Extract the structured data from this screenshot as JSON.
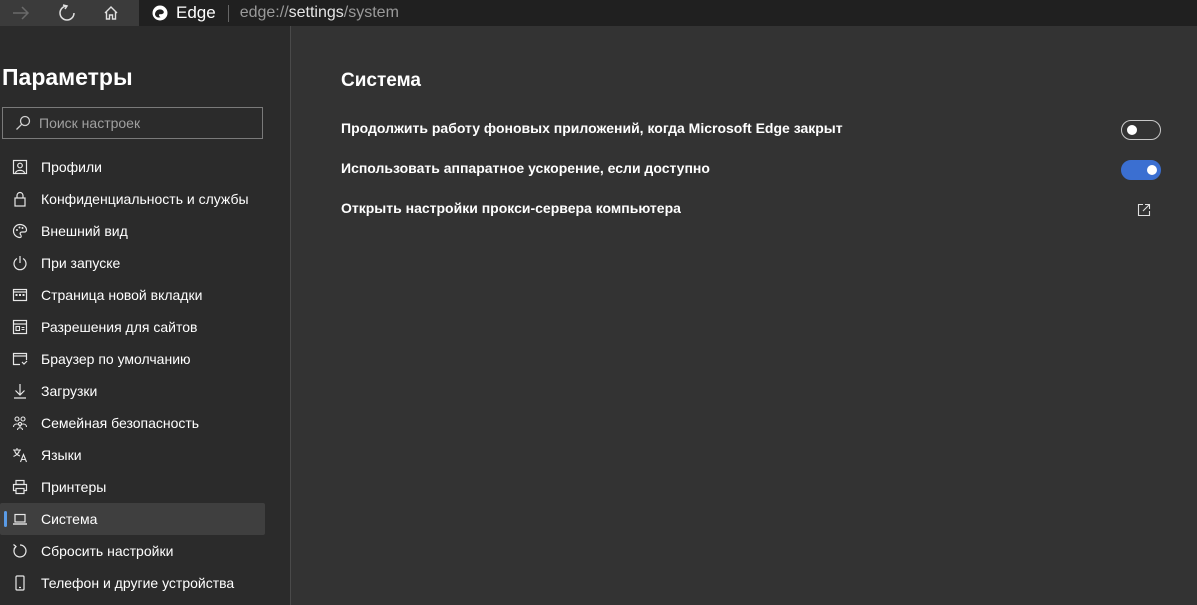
{
  "browser": {
    "name": "Edge",
    "url_scheme": "edge://",
    "url_host": "settings",
    "url_path": "/system"
  },
  "sidebar": {
    "title": "Параметры",
    "search_placeholder": "Поиск настроек",
    "items": [
      {
        "label": "Профили",
        "icon": "profile-icon"
      },
      {
        "label": "Конфиденциальность и службы",
        "icon": "lock-icon"
      },
      {
        "label": "Внешний вид",
        "icon": "palette-icon"
      },
      {
        "label": "При запуске",
        "icon": "power-icon"
      },
      {
        "label": "Страница новой вкладки",
        "icon": "new-tab-icon"
      },
      {
        "label": "Разрешения для сайтов",
        "icon": "site-permissions-icon"
      },
      {
        "label": "Браузер по умолчанию",
        "icon": "default-browser-icon"
      },
      {
        "label": "Загрузки",
        "icon": "download-icon"
      },
      {
        "label": "Семейная безопасность",
        "icon": "family-icon"
      },
      {
        "label": "Языки",
        "icon": "languages-icon"
      },
      {
        "label": "Принтеры",
        "icon": "printer-icon"
      },
      {
        "label": "Система",
        "icon": "laptop-icon",
        "active": true
      },
      {
        "label": "Сбросить настройки",
        "icon": "reset-icon"
      },
      {
        "label": "Телефон и другие устройства",
        "icon": "phone-icon"
      }
    ]
  },
  "main": {
    "title": "Система",
    "settings": [
      {
        "label": "Продолжить работу фоновых приложений, когда Microsoft Edge закрыт",
        "control": "toggle",
        "state": "off"
      },
      {
        "label": "Использовать аппаратное ускорение, если доступно",
        "control": "toggle",
        "state": "on"
      },
      {
        "label": "Открыть настройки прокси-сервера компьютера",
        "control": "external-link"
      }
    ]
  },
  "colors": {
    "accent": "#3b6fd1",
    "indicator": "#5a9be6",
    "sidebar_bg": "#2b2b2b",
    "main_bg": "#333333"
  }
}
